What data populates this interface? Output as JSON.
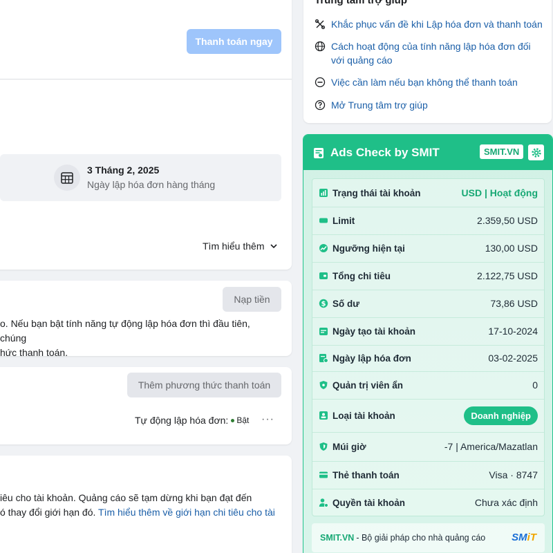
{
  "main": {
    "pay_now_label": "Thanh toán ngay",
    "billing_date": "3 Tháng 2, 2025",
    "billing_date_caption": "Ngày lập hóa đơn hàng tháng",
    "learn_more_label": "Tìm hiểu thêm",
    "top_up_label": "Nạp tiền",
    "funds_text_line1": "o. Nếu bạn bật tính năng tự động lập hóa đơn thì đầu tiên, chúng",
    "funds_text_line2": "hức thanh toán.",
    "add_payment_method_label": "Thêm phương thức thanh toán",
    "auto_billing_label": "Tự động lập hóa đơn:",
    "auto_billing_value": "Bật",
    "more_label": "···",
    "limit_text_line1": "iêu cho tài khoản. Quảng cáo sẽ tạm dừng khi bạn đạt đến",
    "limit_text_line2_prefix": "ó thay đổi giới hạn đó.",
    "limit_text_link": "Tìm hiểu thêm về giới hạn chi tiêu cho tài"
  },
  "help_center": {
    "title": "Trung tâm trợ giúp",
    "items": [
      {
        "label": "Khắc phục vấn đề khi Lập hóa đơn và thanh toán",
        "icon": "tools-icon"
      },
      {
        "label": "Cách hoạt động của tính năng lập hóa đơn đối với quảng cáo",
        "icon": "globe-icon"
      },
      {
        "label": "Việc cần làm nếu bạn không thể thanh toán",
        "icon": "minus-circle-icon"
      },
      {
        "label": "Mở Trung tâm trợ giúp",
        "icon": "question-circle-icon"
      }
    ]
  },
  "smit": {
    "title": "Ads Check by SMIT",
    "badge": "SMIT.VN",
    "rows": [
      {
        "label": "Trạng thái tài khoản",
        "value": "USD | Hoạt động",
        "icon": "chart-icon"
      },
      {
        "label": "Limit",
        "value": "2.359,50 USD",
        "icon": "card-icon"
      },
      {
        "label": "Ngưỡng hiện tại",
        "value": "130,00 USD",
        "icon": "trend-icon"
      },
      {
        "label": "Tổng chi tiêu",
        "value": "2.122,75 USD",
        "icon": "wallet-icon"
      },
      {
        "label": "Số dư",
        "value": "73,86 USD",
        "icon": "dollar-icon"
      },
      {
        "label": "Ngày tạo tài khoản",
        "value": "17-10-2024",
        "icon": "calendar-icon"
      },
      {
        "label": "Ngày lập hóa đơn",
        "value": "03-02-2025",
        "icon": "invoice-icon"
      },
      {
        "label": "Quản trị viên ẩn",
        "value": "0",
        "icon": "shield-eye-icon"
      },
      {
        "label": "Loại tài khoản",
        "value": "Doanh nghiệp",
        "icon": "id-icon"
      },
      {
        "label": "Múi giờ",
        "value": "-7 | America/Mazatlan",
        "icon": "shield-icon"
      },
      {
        "label": "Thẻ thanh toán",
        "value": "Visa · 8747",
        "icon": "credit-card-icon"
      },
      {
        "label": "Quyền tài khoản",
        "value": "Chưa xác định",
        "icon": "user-gear-icon"
      }
    ],
    "footer_brand": "SMIT.VN",
    "footer_text": "- Bộ giải pháp cho nhà quảng cáo",
    "footer_logo_a": "SM",
    "footer_logo_b": "iT",
    "accent": "#1fbf88"
  }
}
